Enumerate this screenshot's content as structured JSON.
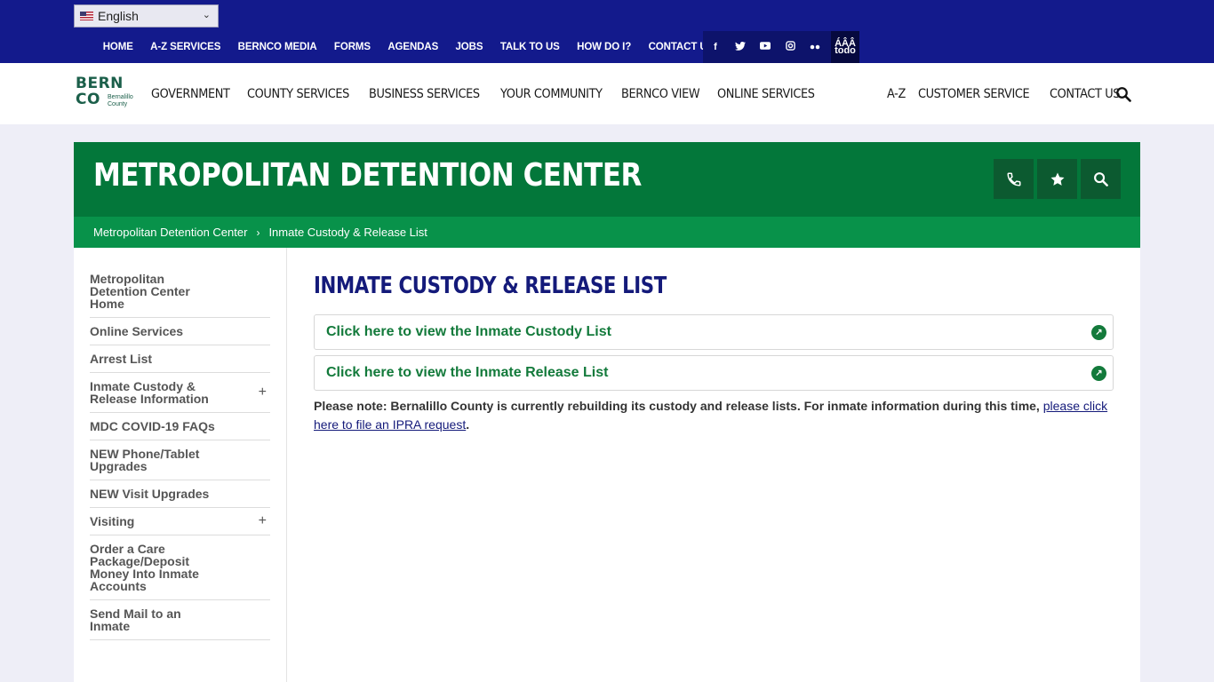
{
  "utility": {
    "language": "English",
    "links": [
      "HOME",
      "A-Z SERVICES",
      "BERNCO MEDIA",
      "FORMS",
      "AGENDAS",
      "JOBS",
      "TALK TO US",
      "HOW DO I?",
      "CONTACT US"
    ],
    "social_icons": [
      "facebook-icon",
      "twitter-icon",
      "youtube-icon",
      "instagram-icon",
      "flickr-icon"
    ],
    "todo_label_top": "ÁÂÂ",
    "todo_label_bottom": "todo"
  },
  "logo": {
    "line1": "BERN",
    "line2": "CO",
    "sub1": "Bernalillo",
    "sub2": "County"
  },
  "nav": {
    "main": [
      "GOVERNMENT",
      "COUNTY SERVICES",
      "BUSINESS SERVICES",
      "YOUR COMMUNITY",
      "BERNCO VIEW",
      "ONLINE SERVICES"
    ],
    "right": [
      "A-Z",
      "CUSTOMER SERVICE",
      "CONTACT US"
    ]
  },
  "banner": {
    "title": "METROPOLITAN DETENTION CENTER"
  },
  "breadcrumb": {
    "home": "Metropolitan Detention Center",
    "current": "Inmate Custody & Release List"
  },
  "sidebar": {
    "items": [
      {
        "label": "Metropolitan Detention Center Home",
        "expand": ""
      },
      {
        "label": "Online Services",
        "expand": ""
      },
      {
        "label": "Arrest List",
        "expand": ""
      },
      {
        "label": "Inmate Custody & Release Information",
        "expand": "+"
      },
      {
        "label": "MDC COVID-19 FAQs",
        "expand": ""
      },
      {
        "label": "NEW Phone/Tablet Upgrades",
        "expand": ""
      },
      {
        "label": "NEW Visit Upgrades",
        "expand": ""
      },
      {
        "label": "Visiting",
        "expand": "+"
      },
      {
        "label": "Order a Care Package/Deposit Money Into Inmate Accounts",
        "expand": ""
      },
      {
        "label": "Send Mail to an Inmate",
        "expand": ""
      }
    ]
  },
  "main": {
    "title": "INMATE CUSTODY & RELEASE LIST",
    "link1": "Click here to view the Inmate Custody List",
    "link2": "Click here to view the Inmate Release List",
    "note_text": "Please note: Bernalillo County is currently rebuilding its custody and release lists. For inmate information during this time, ",
    "note_link": "please click here to file an IPRA request",
    "note_end": "."
  },
  "colors": {
    "utility_bg": "#131a8c",
    "banner_green": "#03773a",
    "breadcrumb_green": "#08924a",
    "title_blue": "#141a7a",
    "link_green": "#137a3b"
  }
}
